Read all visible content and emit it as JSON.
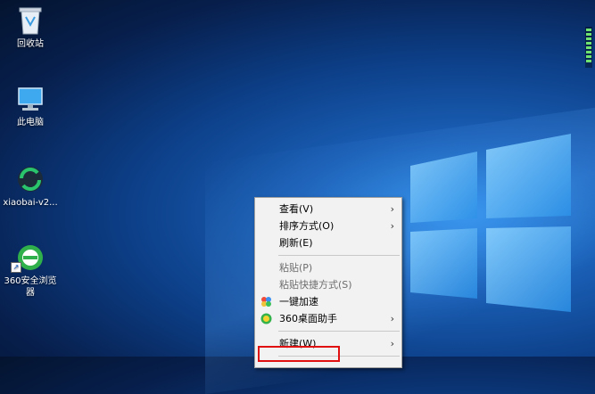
{
  "desktop": {
    "icons": [
      {
        "label": "回收站"
      },
      {
        "label": "此电脑"
      },
      {
        "label": "xiaobai-v2..."
      },
      {
        "label": "360安全浏览器"
      }
    ]
  },
  "context_menu": {
    "items": [
      {
        "label": "查看(V)",
        "submenu": true,
        "enabled": true
      },
      {
        "label": "排序方式(O)",
        "submenu": true,
        "enabled": true
      },
      {
        "label": "刷新(E)",
        "submenu": false,
        "enabled": true
      },
      {
        "label": "粘贴(P)",
        "submenu": false,
        "enabled": false
      },
      {
        "label": "粘贴快捷方式(S)",
        "submenu": false,
        "enabled": false
      },
      {
        "label": "一键加速",
        "submenu": false,
        "enabled": true,
        "icon": "360-boost-icon"
      },
      {
        "label": "360桌面助手",
        "submenu": true,
        "enabled": true,
        "icon": "360-desktop-assistant-icon"
      },
      {
        "label": "新建(W)",
        "submenu": true,
        "enabled": true
      }
    ],
    "arrow_glyph": "›"
  },
  "colors": {
    "accent_blue": "#1a5fb6",
    "highlight_red": "#e01010",
    "menu_bg": "#f2f2f2"
  }
}
